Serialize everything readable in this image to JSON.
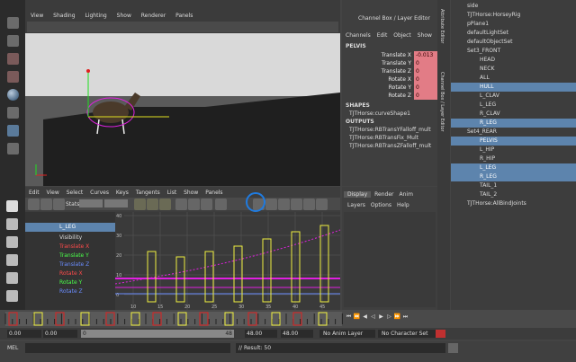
{
  "viewport": {
    "menu": [
      "View",
      "Shading",
      "Lighting",
      "Show",
      "Renderer",
      "Panels"
    ]
  },
  "channel_box": {
    "title": "Channel Box / Layer Editor",
    "menu": [
      "Channels",
      "Edit",
      "Object",
      "Show"
    ],
    "object": "PELVIS",
    "channels": [
      {
        "label": "Translate X",
        "value": "-0.013"
      },
      {
        "label": "Translate Y",
        "value": "0"
      },
      {
        "label": "Translate Z",
        "value": "0"
      },
      {
        "label": "Rotate X",
        "value": "0"
      },
      {
        "label": "Rotate Y",
        "value": "0"
      },
      {
        "label": "Rotate Z",
        "value": "0"
      }
    ],
    "shapes_header": "SHAPES",
    "shapes": [
      "TJTHorse:curveShape1"
    ],
    "outputs_header": "OUTPUTS",
    "outputs": [
      "TJTHorse:RBTransYFalloff_mult",
      "TJTHorse:RBTransFix_Mult",
      "TJTHorse:RBTransZFalloff_mult"
    ],
    "side_tabs": [
      "Attribute Editor",
      "Channel Box / Layer Editor"
    ]
  },
  "layer_editor": {
    "tabs": [
      "Display",
      "Render",
      "Anim"
    ],
    "menu": [
      "Layers",
      "Options",
      "Help"
    ]
  },
  "outliner": {
    "items": [
      {
        "label": "side",
        "sel": false,
        "indent": 0
      },
      {
        "label": "TJTHorse:HorseyRig",
        "sel": false,
        "indent": 0
      },
      {
        "label": "pPlane1",
        "sel": false,
        "indent": 0
      },
      {
        "label": "defaultLightSet",
        "sel": false,
        "indent": 0
      },
      {
        "label": "defaultObjectSet",
        "sel": false,
        "indent": 0
      },
      {
        "label": "Set3_FRONT",
        "sel": false,
        "indent": 0
      },
      {
        "label": "HEAD",
        "sel": false,
        "indent": 1
      },
      {
        "label": "NECK",
        "sel": false,
        "indent": 1
      },
      {
        "label": "ALL",
        "sel": false,
        "indent": 1
      },
      {
        "label": "HULL",
        "sel": true,
        "indent": 1
      },
      {
        "label": "L_CLAV",
        "sel": false,
        "indent": 1
      },
      {
        "label": "L_LEG",
        "sel": false,
        "indent": 1
      },
      {
        "label": "R_CLAV",
        "sel": false,
        "indent": 1
      },
      {
        "label": "R_LEG",
        "sel": true,
        "indent": 1
      },
      {
        "label": "Set4_REAR",
        "sel": false,
        "indent": 0
      },
      {
        "label": "PELVIS",
        "sel": true,
        "indent": 1
      },
      {
        "label": "L_HIP",
        "sel": false,
        "indent": 1
      },
      {
        "label": "R_HIP",
        "sel": false,
        "indent": 1
      },
      {
        "label": "L_LEG",
        "sel": true,
        "indent": 1
      },
      {
        "label": "R_LEG",
        "sel": true,
        "indent": 1
      },
      {
        "label": "TAIL_1",
        "sel": false,
        "indent": 1
      },
      {
        "label": "TAIL_2",
        "sel": false,
        "indent": 1
      },
      {
        "label": "TJTHorse:AllBindJoints",
        "sel": false,
        "indent": 0
      }
    ]
  },
  "graph_editor": {
    "menu": [
      "Edit",
      "View",
      "Select",
      "Curves",
      "Keys",
      "Tangents",
      "List",
      "Show",
      "Panels"
    ],
    "stats_label": "Stats",
    "node": "L_LEG",
    "attributes": [
      {
        "label": "Visibility",
        "color": "#dddddd"
      },
      {
        "label": "Translate X",
        "color": "#ff4a4a"
      },
      {
        "label": "Translate Y",
        "color": "#4aff4a"
      },
      {
        "label": "Translate Z",
        "color": "#6a8cff"
      },
      {
        "label": "Rotate X",
        "color": "#ff4a4a"
      },
      {
        "label": "Rotate Y",
        "color": "#4aff4a"
      },
      {
        "label": "Rotate Z",
        "color": "#6a8cff"
      }
    ],
    "y_ticks": [
      "40",
      "30",
      "20",
      "10",
      "0"
    ],
    "x_ticks": [
      "10",
      "15",
      "20",
      "25",
      "30",
      "35",
      "40",
      "45"
    ]
  },
  "time_slider": {
    "start": "0.00",
    "start2": "0.00",
    "range_start": "0",
    "range_end": "48",
    "end": "48.00",
    "end2": "48.00"
  },
  "bottom": {
    "anim_layer": "No Anim Layer",
    "char_set": "No Character Set",
    "mel_label": "MEL",
    "result": "// Result: 50"
  },
  "colors": {
    "accent_yellow": "#f0f040",
    "accent_red": "#e02020",
    "annot_blue": "#1f7be0",
    "curve_magenta": "#e020e0"
  }
}
